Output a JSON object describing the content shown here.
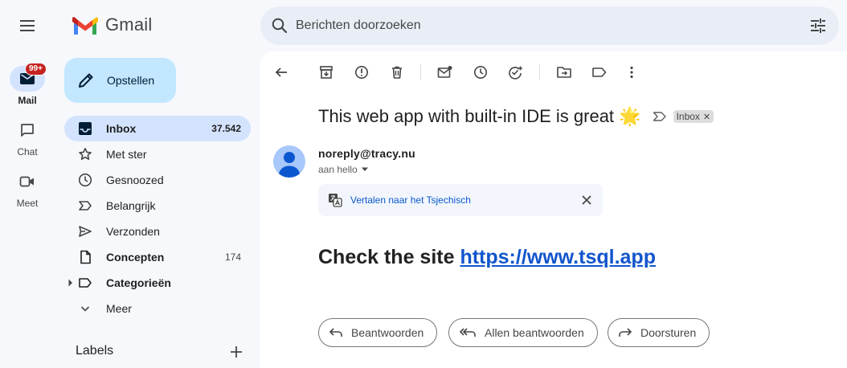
{
  "app": {
    "logo_text": "Gmail",
    "menu_icon": "hamburger-menu-icon",
    "colors": {
      "compose_bg": "#c2e7ff",
      "active_nav": "#d3e3fd",
      "link": "#1155cc",
      "badge": "#c5221f"
    }
  },
  "rail": {
    "mail": {
      "label": "Mail",
      "badge": "99+",
      "icon": "mail-icon"
    },
    "chat": {
      "label": "Chat",
      "icon": "chat-icon"
    },
    "meet": {
      "label": "Meet",
      "icon": "video-icon"
    }
  },
  "search": {
    "placeholder": "Berichten doorzoeken"
  },
  "compose": {
    "label": "Opstellen"
  },
  "nav": {
    "items": [
      {
        "label": "Inbox",
        "count": "37.542",
        "icon": "inbox-icon",
        "active": true
      },
      {
        "label": "Met ster",
        "count": "",
        "icon": "star-icon"
      },
      {
        "label": "Gesnoozed",
        "count": "",
        "icon": "clock-icon"
      },
      {
        "label": "Belangrijk",
        "count": "",
        "icon": "important-icon"
      },
      {
        "label": "Verzonden",
        "count": "",
        "icon": "send-icon"
      },
      {
        "label": "Concepten",
        "count": "174",
        "icon": "draft-icon"
      },
      {
        "label": "Categorieën",
        "count": "",
        "icon": "label-icon"
      },
      {
        "label": "Meer",
        "count": "",
        "icon": "chevron-down-icon"
      }
    ],
    "labels_heading": "Labels"
  },
  "message": {
    "subject": "This web app with built-in IDE is great 🌟",
    "chip": "Inbox",
    "sender": "noreply@tracy.nu",
    "recipient": "aan hello",
    "translate_link": "Vertalen naar het Tsjechisch",
    "body_prefix": "Check the site ",
    "body_link": "https://www.tsql.app"
  },
  "actions": {
    "reply": "Beantwoorden",
    "reply_all": "Allen beantwoorden",
    "forward": "Doorsturen"
  }
}
